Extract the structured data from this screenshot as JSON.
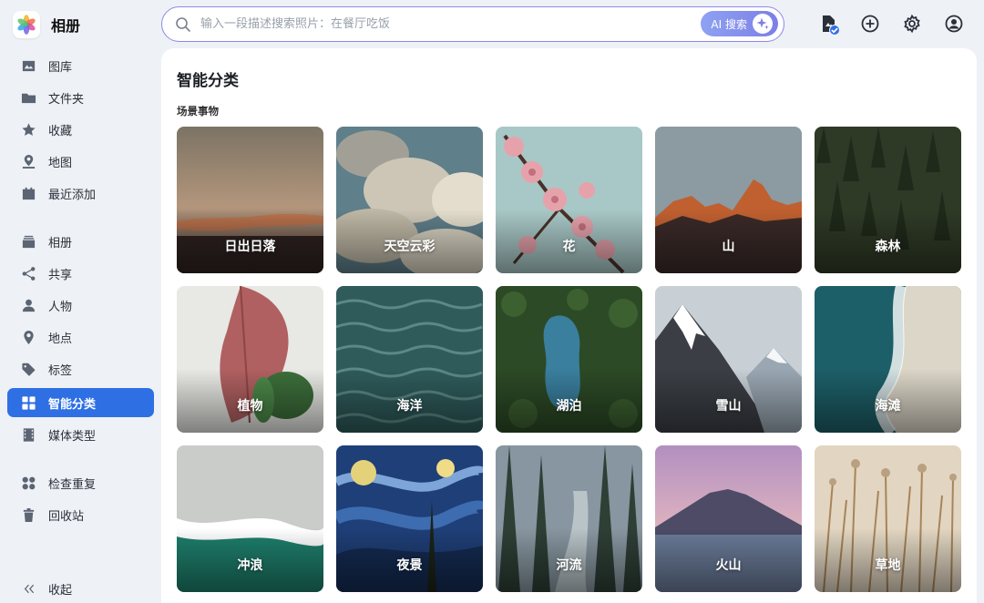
{
  "app": {
    "name": "相册"
  },
  "sidebar": {
    "items": [
      {
        "label": "图库",
        "icon": "image-icon"
      },
      {
        "label": "文件夹",
        "icon": "folder-icon"
      },
      {
        "label": "收藏",
        "icon": "star-icon"
      },
      {
        "label": "地图",
        "icon": "map-pin-icon"
      },
      {
        "label": "最近添加",
        "icon": "calendar-icon"
      },
      {
        "label": "相册",
        "icon": "album-stack-icon"
      },
      {
        "label": "共享",
        "icon": "share-icon"
      },
      {
        "label": "人物",
        "icon": "person-icon"
      },
      {
        "label": "地点",
        "icon": "location-icon"
      },
      {
        "label": "标签",
        "icon": "tag-icon"
      },
      {
        "label": "智能分类",
        "icon": "grid-icon",
        "active": true
      },
      {
        "label": "媒体类型",
        "icon": "film-icon"
      },
      {
        "label": "检查重复",
        "icon": "duplicate-icon"
      },
      {
        "label": "回收站",
        "icon": "trash-icon"
      }
    ],
    "collapse_label": "收起"
  },
  "search": {
    "placeholder": "输入一段描述搜索照片：在餐厅吃饭",
    "ai_button_label": "AI 搜索"
  },
  "toolbar": {
    "icons": [
      "upload-status-icon",
      "add-icon",
      "settings-icon",
      "account-icon"
    ]
  },
  "main": {
    "title": "智能分类",
    "section_title": "场景事物",
    "tiles": [
      {
        "label": "日出日落"
      },
      {
        "label": "天空云彩"
      },
      {
        "label": "花"
      },
      {
        "label": "山"
      },
      {
        "label": "森林"
      },
      {
        "label": "植物"
      },
      {
        "label": "海洋"
      },
      {
        "label": "湖泊"
      },
      {
        "label": "雪山"
      },
      {
        "label": "海滩"
      },
      {
        "label": "冲浪"
      },
      {
        "label": "夜景"
      },
      {
        "label": "河流"
      },
      {
        "label": "火山"
      },
      {
        "label": "草地"
      }
    ]
  },
  "colors": {
    "accent": "#2f6fe4",
    "ai_gradient_start": "#8ea2f2",
    "ai_gradient_end": "#7d7fe6"
  }
}
